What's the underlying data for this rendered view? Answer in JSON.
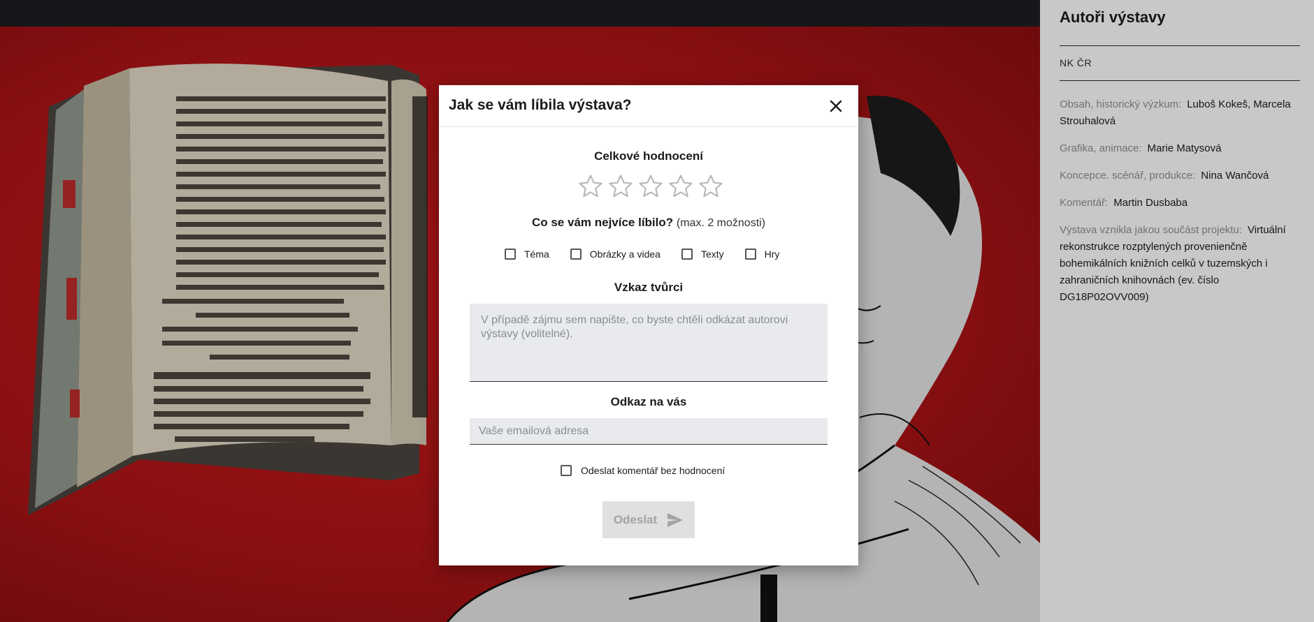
{
  "panel": {
    "title": "Autoři výstavy",
    "org": "NK ČR",
    "credits": [
      {
        "label": "Obsah, historický výzkum:",
        "value": "Luboš Kokeš, Marcela Strouhalová"
      },
      {
        "label": "Grafika, animace:",
        "value": "Marie Matysová"
      },
      {
        "label": "Koncepce. scénář, produkce:",
        "value": "Nina Wančová"
      },
      {
        "label": "Komentář:",
        "value": "Martin Dusbaba"
      },
      {
        "label": "Výstava vznikla jakou součást projektu:",
        "value": "Virtuální rekonstrukce rozptylených provenienčně bohemikálních knižních celků v tuzemských i zahraničních knihovnách (ev. číslo DG18P02OVV009)"
      }
    ]
  },
  "modal": {
    "title": "Jak se vám líbila výstava?",
    "rating_heading": "Celkové hodnocení",
    "rating": {
      "max": 5,
      "selected": 0
    },
    "question_bold": "Co se vám nejvíce líbilo?",
    "question_hint": "(max. 2 možnosti)",
    "options": [
      "Téma",
      "Obrázky a videa",
      "Texty",
      "Hry"
    ],
    "message_heading": "Vzkaz tvůrci",
    "message_placeholder": "V případě zájmu sem napište, co byste chtěli odkázat autorovi výstavy (volitelné).",
    "contact_heading": "Odkaz na vás",
    "email_placeholder": "Vaše emailová adresa",
    "no_rating_label": "Odeslat komentář bez hodnocení",
    "submit_label": "Odeslat"
  },
  "colors": {
    "background_red": "#b3161a",
    "panel_bg": "#f4f4f4",
    "topbar": "#1b1d20",
    "star_outline": "#b5b5b5",
    "submit_disabled_bg": "#e0e0e0",
    "submit_disabled_text": "#a3a3a3"
  },
  "icons": {
    "close": "close-icon",
    "star": "star-outline-icon",
    "send": "send-icon"
  }
}
